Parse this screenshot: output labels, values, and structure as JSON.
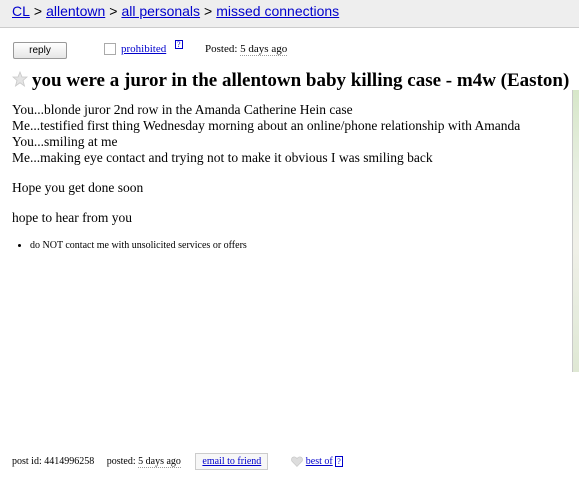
{
  "breadcrumb": {
    "items": [
      "CL",
      "allentown",
      "all personals",
      "missed connections"
    ],
    "separator": ">"
  },
  "actions": {
    "reply_label": "reply",
    "flag_label": "prohibited",
    "flag_help": "?",
    "posted_prefix": "Posted:",
    "posted_value": "5 days ago"
  },
  "post": {
    "title": "you were a juror in the allentown baby killing case - m4w (Easton)",
    "body_lines": [
      "You...blonde juror 2nd row in the Amanda Catherine Hein case",
      "Me...testified first thing Wednesday morning about an online/phone relationship with Amanda",
      "You...smiling at me",
      "Me...making eye contact and trying not to make it obvious I was smiling back"
    ],
    "paragraph_2": "Hope you get done soon",
    "paragraph_3": "hope to hear from you",
    "notices": [
      "do NOT contact me with unsolicited services or offers"
    ]
  },
  "footer": {
    "post_id_label": "post id: 4414996258",
    "posted_label": "posted:",
    "posted_value": "5 days ago",
    "email_label": "email to friend",
    "bestof_label": "best of",
    "bestof_help": "?"
  },
  "colors": {
    "link": "#0000cc",
    "topbar_bg": "#eeeeee"
  }
}
